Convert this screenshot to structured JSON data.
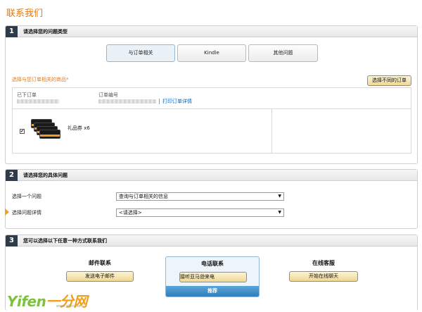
{
  "page_title": "联系我们",
  "sections": {
    "s1": {
      "number": "1",
      "title": "请选择您的问题类型",
      "tabs": [
        "与订单相关",
        "Kindle",
        "其他问题"
      ],
      "select_prompt": "选择与您订单相关的商品",
      "select_prompt_marker": "*",
      "alt_order_button": "选择不同的订单",
      "order": {
        "placed_label": "已下订单",
        "number_label": "订单编号",
        "print_link": "打印订单详情",
        "item_checked": "✔",
        "item_name": "礼品券 x6",
        "item_image_icon": "gift-card-stack-icon"
      }
    },
    "s2": {
      "number": "2",
      "title": "请选择您的具体问题",
      "question_label": "选择一个问题",
      "detail_label": "选择问题详情",
      "question_value": "查询与订单相关的信息",
      "detail_value": "<请选择>",
      "caret": "▼"
    },
    "s3": {
      "number": "3",
      "title": "您可以选择以下任意一种方式联系我们",
      "email": {
        "title": "邮件联系",
        "button": "发送电子邮件"
      },
      "phone": {
        "title": "电话联系",
        "button": "接听亚马逊来电",
        "badge": "推荐"
      },
      "chat": {
        "title": "在线客服",
        "button": "开始在线聊天"
      }
    }
  },
  "watermark": {
    "text_a": "Yifen",
    "text_b": "一分网",
    "url": "www.yifen.com"
  },
  "colors": {
    "accent_orange": "#e47911",
    "step_badge": "#2e3b4a",
    "link_blue": "#0066c0",
    "button_gold": "#efd890",
    "recommend_blue": "#2f7fbd"
  }
}
